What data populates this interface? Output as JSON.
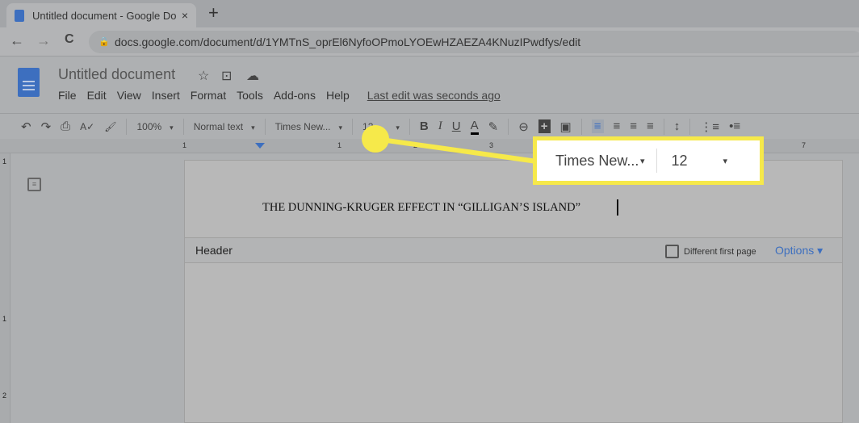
{
  "browser": {
    "tab_title": "Untitled document - Google Docs",
    "close_icon": "×",
    "new_tab": "+",
    "back": "←",
    "forward": "→",
    "reload": "C",
    "lock_icon": "🔒",
    "url": "docs.google.com/document/d/1YMTnS_oprEl6NyfoOPmoLYOEwHZAEZA4KNuzIPwdfys/edit"
  },
  "docs": {
    "title": "Untitled document",
    "star": "☆",
    "folder": "⊡",
    "cloud": "☁",
    "menu": [
      "File",
      "Edit",
      "View",
      "Insert",
      "Format",
      "Tools",
      "Add-ons",
      "Help"
    ],
    "last_edit": "Last edit was seconds ago"
  },
  "toolbar": {
    "undo": "↶",
    "redo": "↷",
    "print": "⎙",
    "spell": "A✓",
    "paint": "🖌",
    "zoom": "100%",
    "style": "Normal text",
    "font": "Times New...",
    "size": "12",
    "bold": "B",
    "italic": "I",
    "underline": "U",
    "text_color": "A",
    "highlight": "✎",
    "link": "⊖",
    "comment": "+",
    "image": "▣",
    "align_left": "≡",
    "align_center": "≡",
    "align_right": "≡",
    "justify": "≡",
    "line_spacing": "↕",
    "numbered": "⋮≡",
    "bulleted": "•≡",
    "caret": "▾"
  },
  "ruler": [
    "1",
    "1",
    "2",
    "3",
    "7"
  ],
  "vruler": [
    "1",
    "1",
    "2"
  ],
  "document": {
    "text": "THE DUNNING-KRUGER EFFECT IN “GILLIGAN’S ISLAND”",
    "header_label": "Header",
    "different_first_page": "Different first page",
    "options": "Options ▾"
  },
  "callout": {
    "font": "Times New...",
    "size": "12",
    "caret": "▾",
    "highlight_color": "#f6e94a"
  },
  "accent_color": "#3d6fbf"
}
